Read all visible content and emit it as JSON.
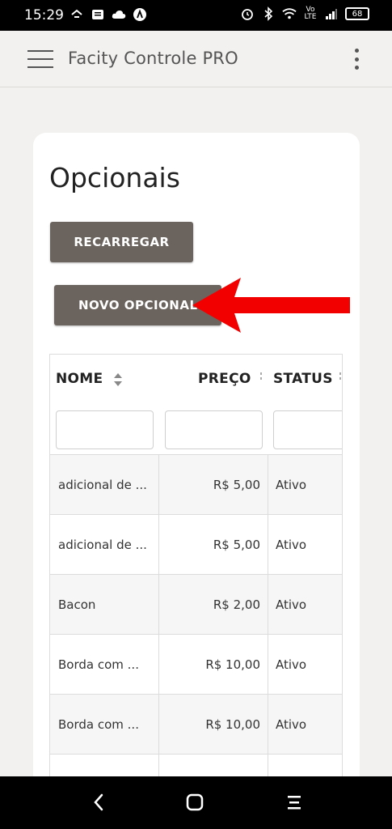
{
  "status_bar": {
    "time": "15:29",
    "battery": "68",
    "network": "Vo LTE"
  },
  "app_bar": {
    "title": "Facity Controle PRO"
  },
  "page": {
    "heading": "Opcionais",
    "buttons": {
      "reload": "RECARREGAR",
      "new_optional": "NOVO OPCIONAL"
    }
  },
  "table": {
    "columns": [
      "NOME",
      "PREÇO",
      "STATUS"
    ],
    "rows": [
      {
        "nome": "adicional de ...",
        "preco": "R$ 5,00",
        "status": "Ativo"
      },
      {
        "nome": "adicional de ...",
        "preco": "R$ 5,00",
        "status": "Ativo"
      },
      {
        "nome": "Bacon",
        "preco": "R$ 2,00",
        "status": "Ativo"
      },
      {
        "nome": "Borda com ...",
        "preco": "R$ 10,00",
        "status": "Ativo"
      },
      {
        "nome": "Borda com ...",
        "preco": "R$ 10,00",
        "status": "Ativo"
      },
      {
        "nome": "",
        "preco": "",
        "status": ""
      }
    ]
  },
  "annotation": {
    "arrow_color": "#f20000"
  },
  "colors": {
    "button_bg": "#6b645e",
    "page_bg": "#f2f1ef"
  }
}
